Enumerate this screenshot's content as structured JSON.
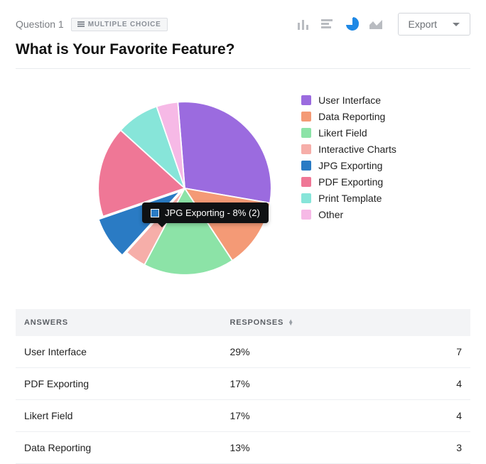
{
  "header": {
    "question_label": "Question 1",
    "badge_label": "MULTIPLE CHOICE",
    "title": "What is Your Favorite Feature?",
    "export_label": "Export"
  },
  "chart_types": {
    "bar": false,
    "hbar": false,
    "pie": true,
    "area": false
  },
  "chart_data": {
    "type": "pie",
    "title": "What is Your Favorite Feature?",
    "series": [
      {
        "name": "User Interface",
        "percent": 29,
        "count": 7,
        "color": "#9b6bdf"
      },
      {
        "name": "Data Reporting",
        "percent": 13,
        "count": 3,
        "color": "#f49a76"
      },
      {
        "name": "Likert Field",
        "percent": 17,
        "count": 4,
        "color": "#8ce3a7"
      },
      {
        "name": "Interactive Charts",
        "percent": 4,
        "count": 1,
        "color": "#f6aea9"
      },
      {
        "name": "JPG Exporting",
        "percent": 8,
        "count": 2,
        "color": "#2a7bc4"
      },
      {
        "name": "PDF Exporting",
        "percent": 17,
        "count": 4,
        "color": "#ef7796"
      },
      {
        "name": "Print Template",
        "percent": 8,
        "count": 2,
        "color": "#87e5d9"
      },
      {
        "name": "Other",
        "percent": 4,
        "count": 1,
        "color": "#f6b9e6"
      }
    ],
    "tooltip": {
      "label": "JPG Exporting",
      "percent": 8,
      "count": 2,
      "color": "#2a7bc4"
    },
    "legend_position": "right"
  },
  "table": {
    "headers": {
      "answers": "ANSWERS",
      "responses": "RESPONSES"
    },
    "rows": [
      {
        "answer": "User Interface",
        "pct": "29%",
        "count": 7
      },
      {
        "answer": "PDF Exporting",
        "pct": "17%",
        "count": 4
      },
      {
        "answer": "Likert Field",
        "pct": "17%",
        "count": 4
      },
      {
        "answer": "Data Reporting",
        "pct": "13%",
        "count": 3
      }
    ]
  }
}
